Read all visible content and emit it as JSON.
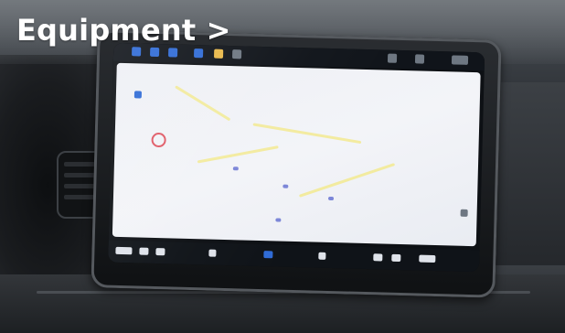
{
  "header": {
    "cta_label": "Equipment >"
  },
  "colors": {
    "cta_text": "#ffffff",
    "accent_blue": "#2f6bd6",
    "map_background": "#eef0f5"
  }
}
